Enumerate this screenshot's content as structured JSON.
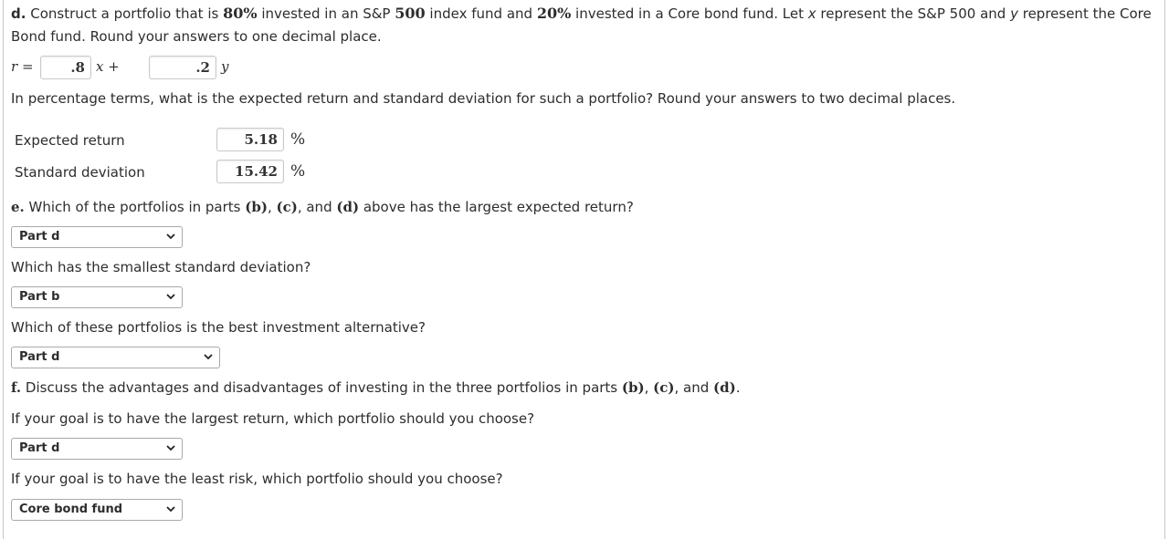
{
  "part_d": {
    "label": "d.",
    "question_parts": [
      "Construct a portfolio that is ",
      "80%",
      " invested in an S&P ",
      "500",
      " index fund and ",
      "20%",
      " invested in a Core bond fund. Let ",
      "x",
      " represent the S&P 500 and ",
      "y",
      " represent the Core"
    ],
    "question_line2": "Bond fund. Round your answers to one decimal place.",
    "equation": {
      "lhs": "r =",
      "x_coef": ".8",
      "x_var": "x +",
      "y_coef": ".2",
      "y_var": "y"
    },
    "followup": "In percentage terms, what is the expected return and standard deviation for such a portfolio? Round your answers to two decimal places.",
    "rows": [
      {
        "label": "Expected return",
        "value": "5.18",
        "unit": "%"
      },
      {
        "label": "Standard deviation",
        "value": "15.42",
        "unit": "%"
      }
    ]
  },
  "part_e": {
    "label": "e.",
    "question": [
      " Which of the portfolios in parts ",
      "(b)",
      ", ",
      "(c)",
      ", and ",
      "(d)",
      " above has the largest expected return?"
    ],
    "answer1": "Part d",
    "question2": "Which has the smallest standard deviation?",
    "answer2": "Part b",
    "question3": "Which of these portfolios is the best investment alternative?",
    "answer3": "Part d"
  },
  "part_f": {
    "label": "f.",
    "question": [
      " Discuss the advantages and disadvantages of investing in the three portfolios in parts ",
      "(b)",
      ", ",
      "(c)",
      ", and ",
      "(d)",
      "."
    ],
    "question2": "If your goal is to have the largest return, which portfolio should you choose?",
    "answer2": "Part d",
    "question3": "If your goal is to have the least risk, which portfolio should you choose?",
    "answer3": "Core bond fund"
  }
}
